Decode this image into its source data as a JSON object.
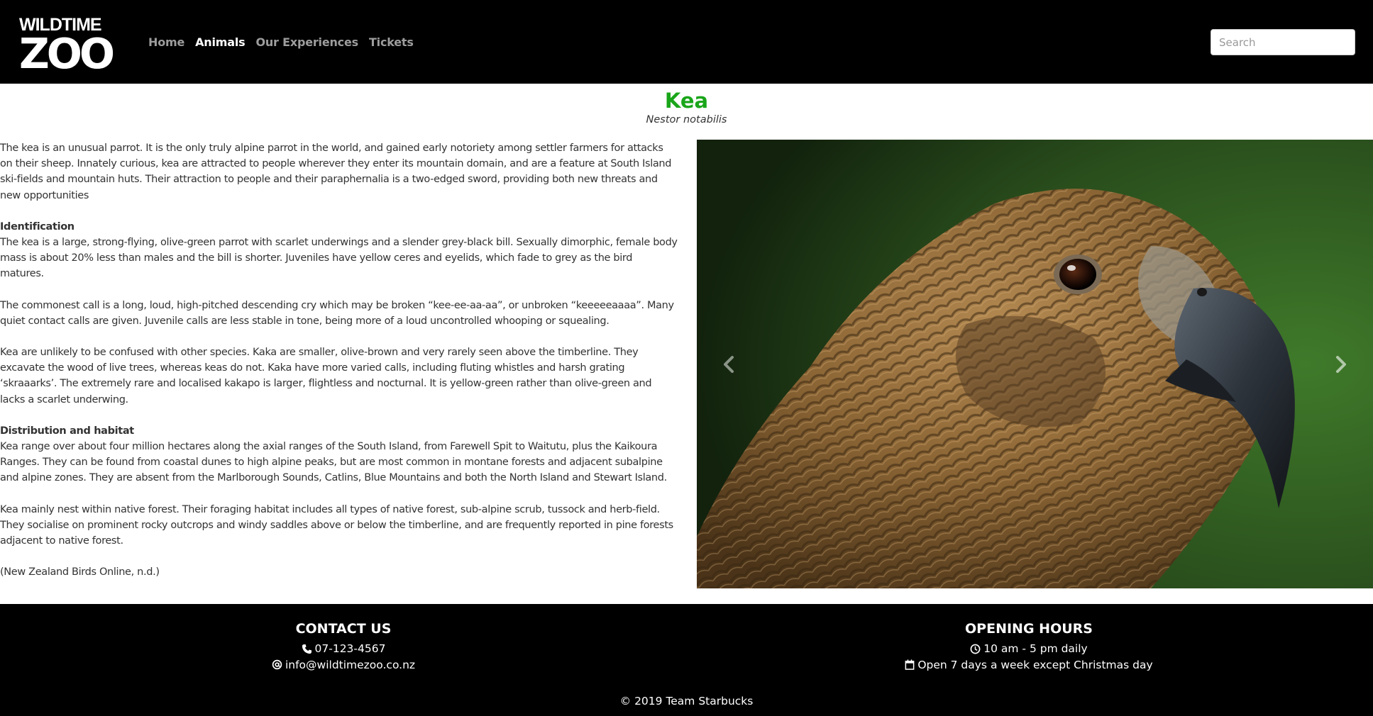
{
  "logo": {
    "line1": "WILDTIME",
    "line2": "ZOO"
  },
  "nav": {
    "items": [
      {
        "label": "Home",
        "active": false
      },
      {
        "label": "Animals",
        "active": true
      },
      {
        "label": "Our Experiences",
        "active": false
      },
      {
        "label": "Tickets",
        "active": false
      }
    ]
  },
  "search": {
    "placeholder": "Search",
    "value": ""
  },
  "animal": {
    "name": "Kea",
    "scientific_name": "Nestor notabilis"
  },
  "description": {
    "intro": "The kea is an unusual parrot. It is the only truly alpine parrot in the world, and gained early notoriety among settler farmers for attacks on their sheep. Innately curious, kea are attracted to people wherever they enter its mountain domain, and are a feature at South Island ski-fields and mountain huts. Their attraction to people and their paraphernalia is a two-edged sword, providing both new threats and new opportunities",
    "identification_heading": "Identification",
    "identification_p1": "The kea is a large, strong-flying, olive-green parrot with scarlet underwings and a slender grey-black bill. Sexually dimorphic, female body mass is about 20% less than males and the bill is shorter. Juveniles have yellow ceres and eyelids, which fade to grey as the bird matures.",
    "identification_p2": "The commonest call is a long, loud, high-pitched descending cry which may be broken “kee-ee-aa-aa”, or unbroken “keeeeeaaaa”. Many quiet contact calls are given. Juvenile calls are less stable in tone, being more of a loud uncontrolled whooping or squealing.",
    "identification_p3": "Kea are unlikely to be confused with other species. Kaka are smaller, olive-brown and very rarely seen above the timberline. They excavate the wood of live trees, whereas keas do not. Kaka have more varied calls, including fluting whistles and harsh grating ‘skraaarks’. The extremely rare and localised kakapo is larger, flightless and nocturnal. It is yellow-green rather than olive-green and lacks a scarlet underwing.",
    "distribution_heading": "Distribution and habitat",
    "distribution_p1": "Kea range over about four million hectares along the axial ranges of the South Island, from Farewell Spit to Waitutu, plus the Kaikoura Ranges. They can be found from coastal dunes to high alpine peaks, but are most common in montane forests and adjacent subalpine and alpine zones. They are absent from the Marlborough Sounds, Catlins, Blue Mountains and both the North Island and Stewart Island.",
    "distribution_p2": "Kea mainly nest within native forest. Their foraging habitat includes all types of native forest, sub-alpine scrub, tussock and herb-field. They socialise on prominent rocky outcrops and windy saddles above or below the timberline, and are frequently reported in pine forests adjacent to native forest.",
    "citation": "(New Zealand Birds Online, n.d.)"
  },
  "carousel": {
    "prev_icon": "chevron-left-icon",
    "next_icon": "chevron-right-icon"
  },
  "footer": {
    "contact_heading": "CONTACT US",
    "phone": "07-123-4567",
    "email": "info@wildtimezoo.co.nz",
    "hours_heading": "OPENING HOURS",
    "hours": "10 am - 5 pm daily",
    "days": "Open 7 days a week except Christmas day",
    "copyright": "© 2019 Team Starbucks"
  },
  "colors": {
    "navbar_bg": "#000000",
    "accent_green": "#1aa61a",
    "nav_inactive": "#9d9d9d",
    "nav_active": "#ffffff"
  }
}
